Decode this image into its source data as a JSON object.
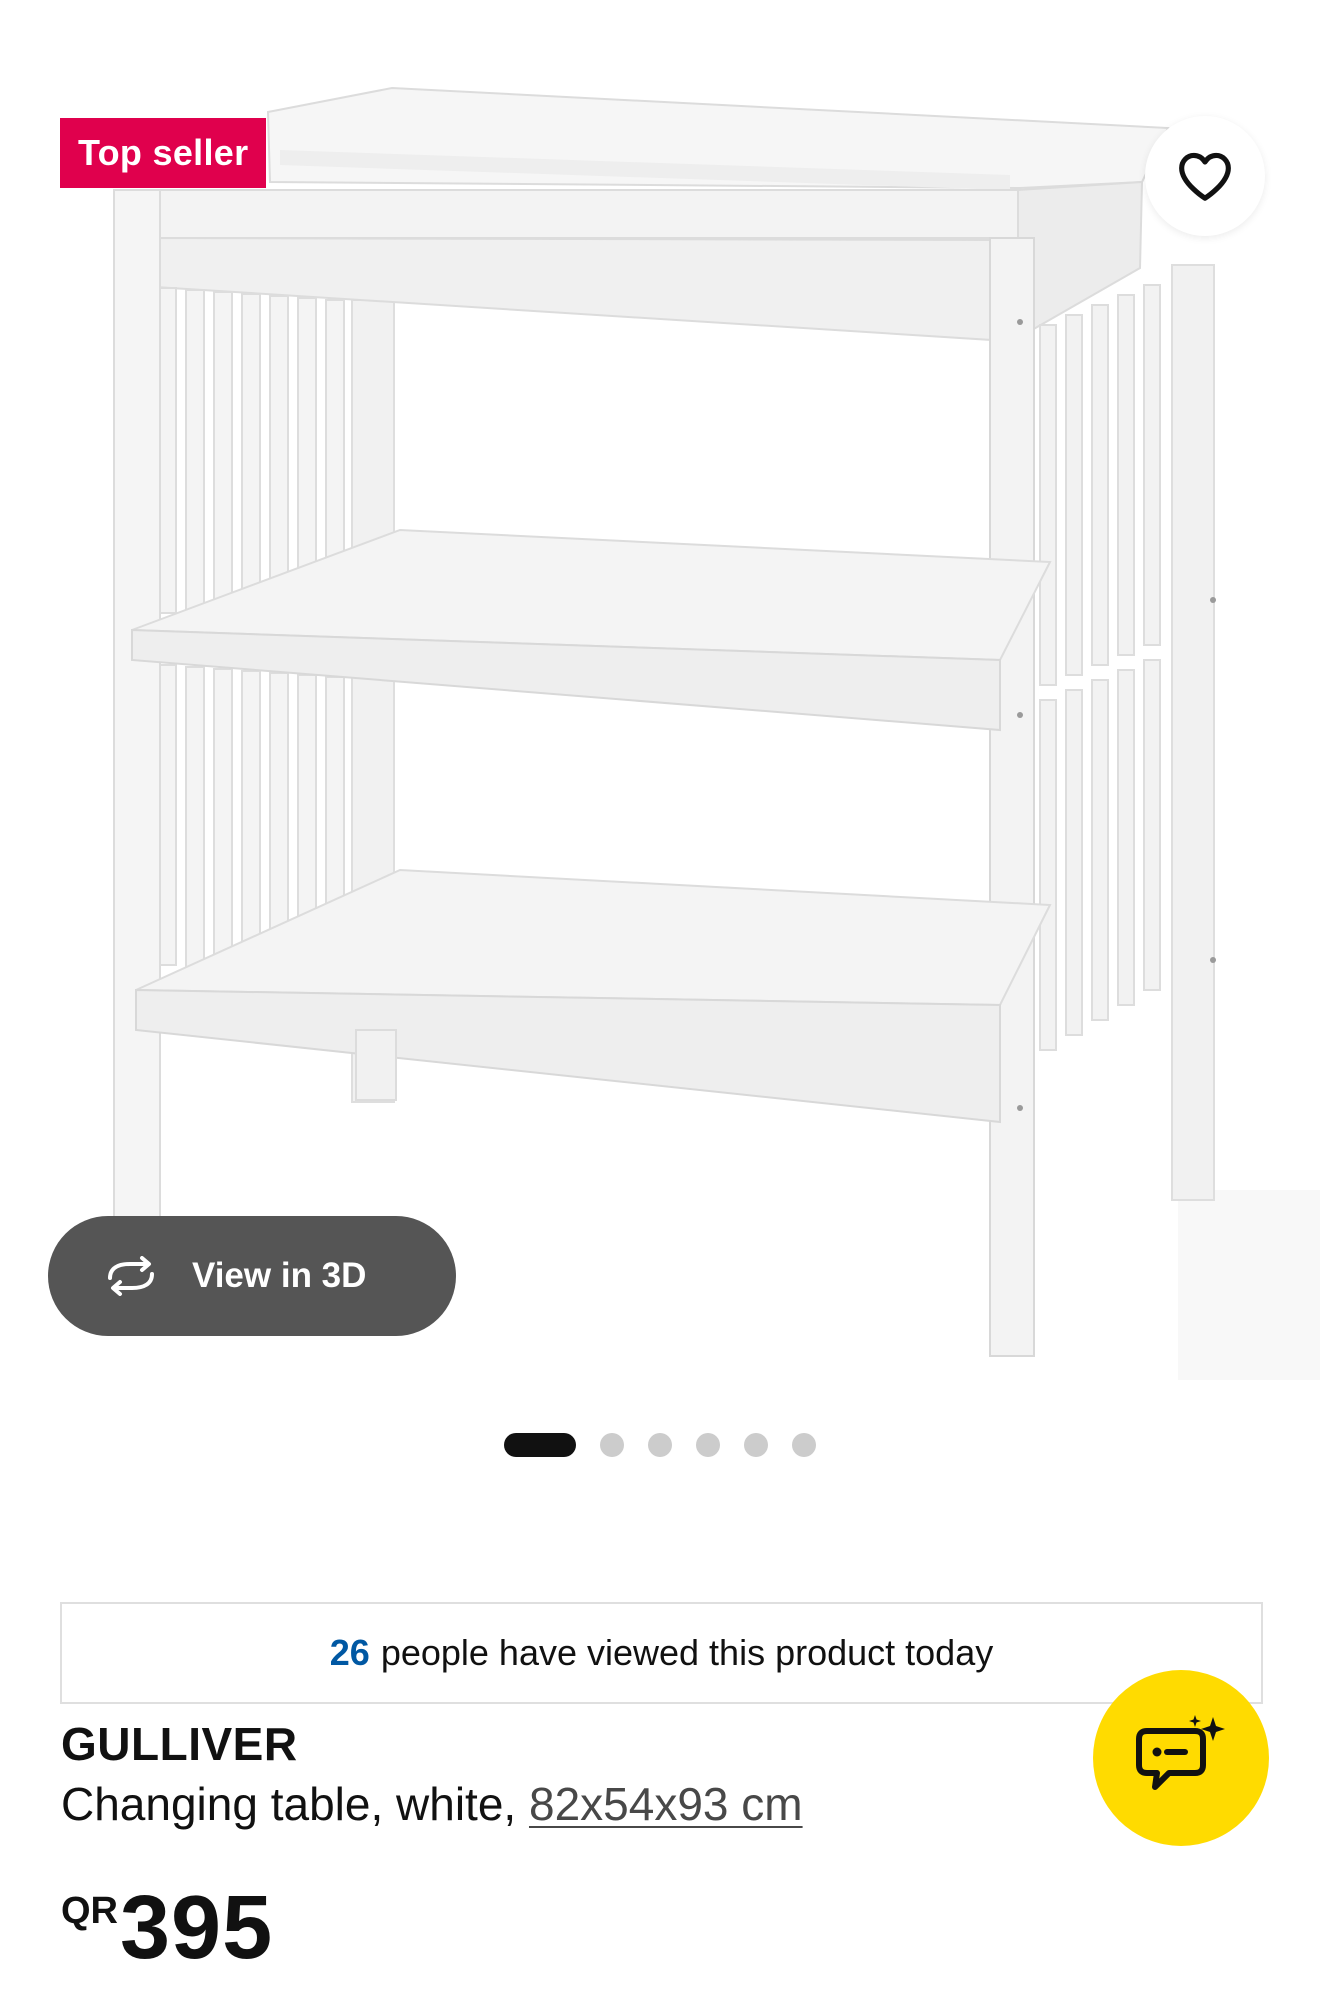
{
  "product": {
    "badge": "Top seller",
    "view_3d_label": "View in 3D",
    "views_count": "26",
    "views_text": "people have viewed this product today",
    "name": "GULLIVER",
    "description": "Changing table, white,",
    "dimensions": "82x54x93 cm",
    "price_currency": "QR",
    "price_amount": "395"
  },
  "gallery": {
    "image_count": 6,
    "active_index": 0
  },
  "icons": {
    "favorite": "heart-outline-icon",
    "view_3d": "rotate-arrows-icon",
    "chat": "chat-sparkle-icon"
  },
  "colors": {
    "badge_bg": "#e0004d",
    "views_count": "#0058a3",
    "chat_fab": "#ffdb00",
    "view3d_bg": "#555555"
  }
}
